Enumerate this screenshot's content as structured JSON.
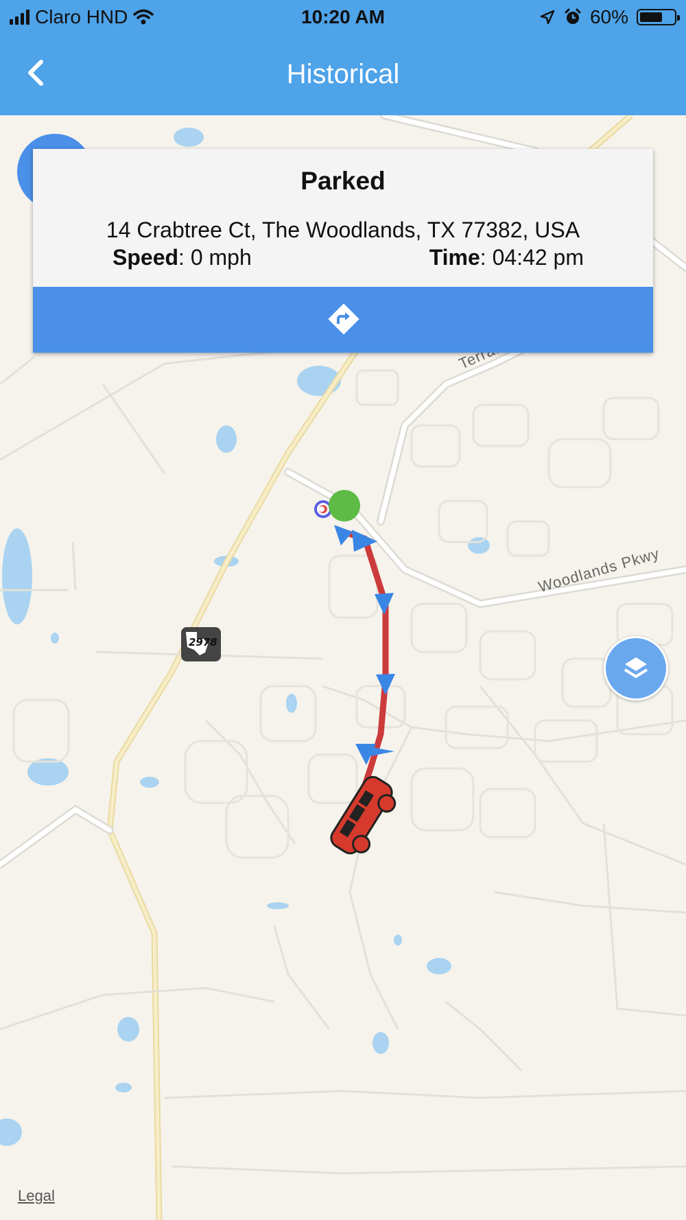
{
  "status_bar": {
    "carrier": "Claro HND",
    "time": "10:20 AM",
    "battery": "60%",
    "battery_level": 0.6
  },
  "header": {
    "title": "Historical",
    "back_icon": "chevron-left-icon"
  },
  "popup": {
    "title": "Parked",
    "address": "14 Crabtree Ct, The Woodlands, TX 77382, USA",
    "speed_label": "Speed",
    "speed_value": ": 0 mph",
    "time_label": "Time",
    "time_value": ": 04:42 pm",
    "directions_icon": "directions-icon"
  },
  "map": {
    "road_labels": {
      "terramont": "Terramo",
      "woodlands": "Woodlands Pkwy"
    },
    "shield_number": "2978",
    "layers_icon": "layers-icon",
    "legal": "Legal"
  },
  "colors": {
    "header": "#4ea3e9",
    "accent": "#4a8fe8",
    "route": "#cc3b3b",
    "start_marker": "#5dbb46",
    "map_bg": "#f6f3ec",
    "water": "#a9d3f0"
  }
}
